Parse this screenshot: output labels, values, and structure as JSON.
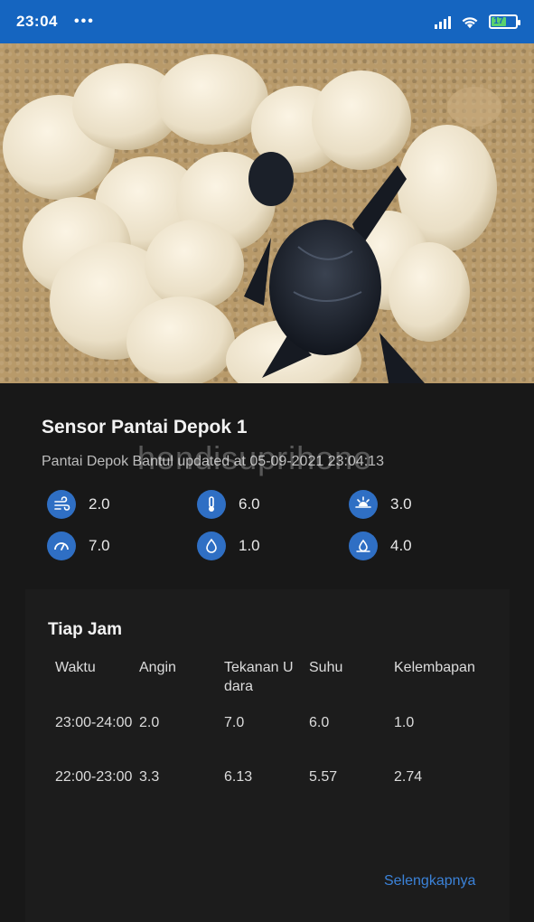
{
  "status_bar": {
    "time": "23:04",
    "dots": "•••",
    "battery": "17"
  },
  "sensor": {
    "title": "Sensor Pantai Depok 1",
    "subtitle": "Pantai Depok Bantul updated at 05-09-2021 23:04:13",
    "watermark": "hendisuprihono"
  },
  "metrics": [
    {
      "icon": "wind-icon",
      "value": "2.0"
    },
    {
      "icon": "thermometer-icon",
      "value": "6.0"
    },
    {
      "icon": "sun-icon",
      "value": "3.0"
    },
    {
      "icon": "pressure-gauge-icon",
      "value": "7.0"
    },
    {
      "icon": "water-drop-icon",
      "value": "1.0"
    },
    {
      "icon": "rain-drop-icon",
      "value": "4.0"
    }
  ],
  "hourly": {
    "title": "Tiap Jam",
    "headers": [
      "Waktu",
      "Angin",
      "Tekanan Udara",
      "Suhu",
      "Kelembapan"
    ],
    "rows": [
      [
        "23:00-24:00",
        "2.0",
        "7.0",
        "6.0",
        "1.0"
      ],
      [
        "22:00-23:00",
        "3.3",
        "6.13",
        "5.57",
        "2.74"
      ]
    ],
    "more_label": "Selengkapnya"
  },
  "colors": {
    "status_bar": "#1565c0",
    "icon_bg": "#2f6fc4",
    "link": "#3b82d8",
    "card_bg": "#181818"
  }
}
